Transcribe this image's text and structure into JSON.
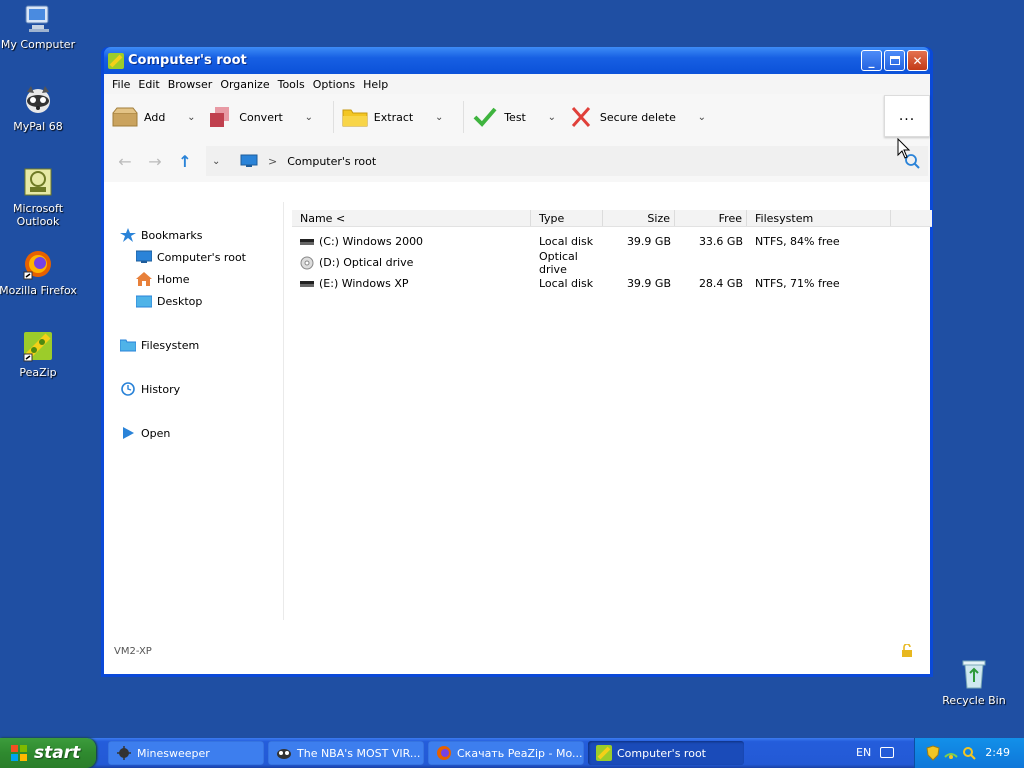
{
  "desktop": {
    "icons": [
      {
        "label": "My Computer",
        "icon": "my-computer-icon"
      },
      {
        "label": "MyPal 68",
        "icon": "mypal-icon"
      },
      {
        "label": "Microsoft Outlook",
        "icon": "outlook-icon"
      },
      {
        "label": "Mozilla Firefox",
        "icon": "firefox-icon"
      },
      {
        "label": "PeaZip",
        "icon": "peazip-icon"
      },
      {
        "label": "Recycle Bin",
        "icon": "recycle-bin-icon"
      }
    ]
  },
  "window": {
    "title": "Computer's root",
    "menu": [
      "File",
      "Edit",
      "Browser",
      "Organize",
      "Tools",
      "Options",
      "Help"
    ],
    "toolbar": {
      "add": "Add",
      "convert": "Convert",
      "extract": "Extract",
      "test": "Test",
      "secure_delete": "Secure delete",
      "more": "..."
    },
    "address": {
      "path": "Computer's root",
      "separator": ">"
    },
    "tree": {
      "bookmarks": "Bookmarks",
      "computers_root": "Computer's root",
      "home": "Home",
      "desktop": "Desktop",
      "filesystem": "Filesystem",
      "history": "History",
      "open": "Open"
    },
    "list": {
      "columns": {
        "name": "Name <",
        "type": "Type",
        "size": "Size",
        "free": "Free",
        "filesystem": "Filesystem"
      },
      "rows": [
        {
          "name": "(C:) Windows 2000",
          "type": "Local disk",
          "size": "39.9 GB",
          "free": "33.6 GB",
          "filesystem": "NTFS, 84% free"
        },
        {
          "name": "(D:) Optical drive",
          "type": "Optical drive",
          "size": "",
          "free": "",
          "filesystem": ""
        },
        {
          "name": "(E:) Windows XP",
          "type": "Local disk",
          "size": "39.9 GB",
          "free": "28.4 GB",
          "filesystem": "NTFS, 71% free"
        }
      ]
    },
    "status": "VM2-XP"
  },
  "taskbar": {
    "start": "start",
    "tasks": [
      {
        "label": "Minesweeper"
      },
      {
        "label": "The NBA's MOST VIR..."
      },
      {
        "label": "Скачать PeaZip - Mo..."
      },
      {
        "label": "Computer's root"
      }
    ],
    "lang": "EN",
    "clock": "2:49"
  },
  "colors": {
    "desktop": "#1f4fa3",
    "titlebar": "#0d53da",
    "accent_blue": "#2a83d8",
    "start_green": "#2f8a2f"
  }
}
